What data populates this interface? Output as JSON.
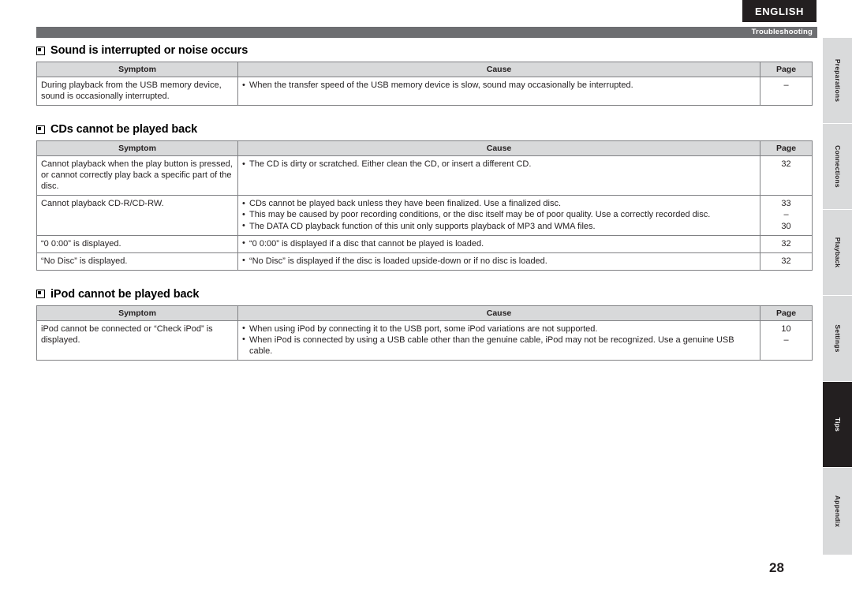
{
  "header": {
    "language_tab": "ENGLISH",
    "bar_label": "Troubleshooting"
  },
  "side_tabs": [
    {
      "label": "Preparations",
      "active": false
    },
    {
      "label": "Connections",
      "active": false
    },
    {
      "label": "Playback",
      "active": false
    },
    {
      "label": "Settings",
      "active": false
    },
    {
      "label": "Tips",
      "active": true
    },
    {
      "label": "Appendix",
      "active": false
    }
  ],
  "columns": {
    "symptom": "Symptom",
    "cause": "Cause",
    "page": "Page"
  },
  "sections": [
    {
      "title": "Sound is interrupted or noise occurs",
      "rows": [
        {
          "symptom": "During playback from the USB memory device, sound is occasionally interrupted.",
          "causes": [
            "When the transfer speed of the USB memory device is slow, sound may occasionally be interrupted."
          ],
          "pages": [
            "–"
          ]
        }
      ]
    },
    {
      "title": "CDs cannot be played back",
      "rows": [
        {
          "symptom": "Cannot playback when the play button is pressed, or cannot correctly play back a specific part of the disc.",
          "causes": [
            "The CD is dirty or scratched. Either clean the CD, or insert a different CD."
          ],
          "pages": [
            "32"
          ]
        },
        {
          "symptom": "Cannot playback CD-R/CD-RW.",
          "causes": [
            "CDs cannot be played back unless they have been finalized. Use a finalized disc.",
            "This may be caused by poor recording conditions, or the disc itself may be of poor quality. Use a correctly recorded disc.",
            "The DATA CD playback function of this unit only supports playback of MP3 and WMA files."
          ],
          "pages": [
            "33",
            "–",
            "30"
          ]
        },
        {
          "symptom": "“0 0:00” is displayed.",
          "causes": [
            "“0 0:00” is displayed if a disc that cannot be played is loaded."
          ],
          "pages": [
            "32"
          ]
        },
        {
          "symptom": "“No Disc” is displayed.",
          "causes": [
            "“No Disc” is displayed if the disc is loaded upside-down or if no disc is loaded."
          ],
          "pages": [
            "32"
          ]
        }
      ]
    },
    {
      "title": "iPod cannot be played back",
      "rows": [
        {
          "symptom": "iPod cannot be connected or “Check iPod” is displayed.",
          "causes": [
            "When using iPod by connecting it to the USB port, some iPod variations are not supported.",
            "When iPod is connected by using a USB cable other than the genuine cable, iPod may not be recognized. Use a genuine USB cable."
          ],
          "pages": [
            "10",
            "–"
          ]
        }
      ]
    }
  ],
  "footer": {
    "page_number": "28"
  }
}
